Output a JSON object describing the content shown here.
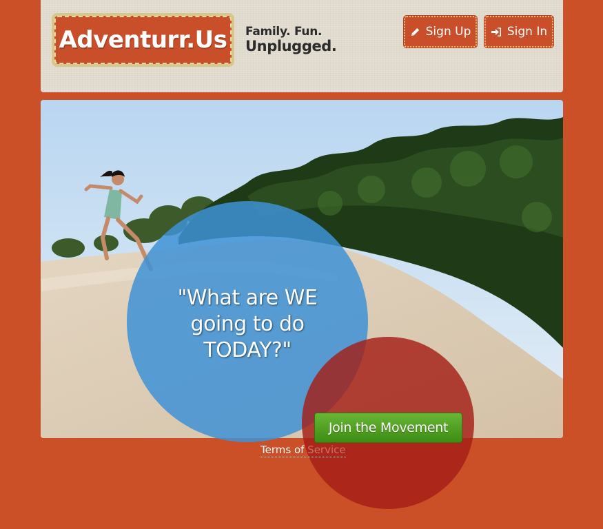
{
  "brand": {
    "logo_text": "Adventurr.Us",
    "tagline_line1": "Family. Fun.",
    "tagline_line2": "Unplugged."
  },
  "header": {
    "signup_label": "Sign Up",
    "signup_icon": "pencil-icon",
    "signin_label": "Sign In",
    "signin_icon": "sign-in-icon"
  },
  "hero": {
    "quote_line1": "\"What are WE",
    "quote_line2": "going to do",
    "quote_line3": "TODAY?\"",
    "cta_label": "Join the Movement",
    "image_description_icon": "hero-photo"
  },
  "footer": {
    "terms_part1": "Terms of ",
    "terms_part2": "Service"
  },
  "colors": {
    "background": "#cb4f27",
    "header_panel": "#e3ddd2",
    "button_orange": "#c94f2a",
    "bubble_blue": "#3e92d6",
    "bubble_red": "#a51e16",
    "cta_green": "#4f9f22"
  }
}
